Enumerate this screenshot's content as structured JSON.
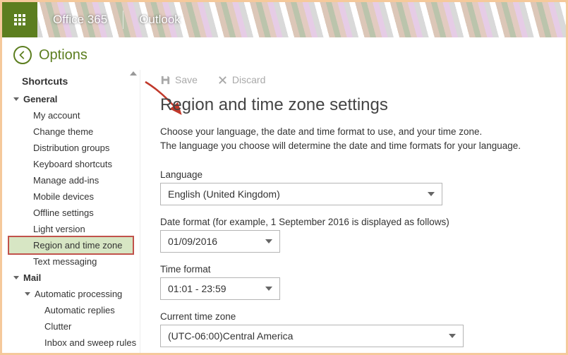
{
  "header": {
    "suite": "Office 365",
    "app": "Outlook"
  },
  "options_label": "Options",
  "sidebar": {
    "shortcuts": "Shortcuts",
    "sections": {
      "general": {
        "label": "General",
        "items": [
          "My account",
          "Change theme",
          "Distribution groups",
          "Keyboard shortcuts",
          "Manage add-ins",
          "Mobile devices",
          "Offline settings",
          "Light version",
          "Region and time zone",
          "Text messaging"
        ]
      },
      "mail": {
        "label": "Mail",
        "auto_processing": {
          "label": "Automatic processing",
          "items": [
            "Automatic replies",
            "Clutter",
            "Inbox and sweep rules"
          ]
        }
      }
    }
  },
  "toolbar": {
    "save": "Save",
    "discard": "Discard"
  },
  "page": {
    "title": "Region and time zone settings",
    "desc1": "Choose your language, the date and time format to use, and your time zone.",
    "desc2": "The language you choose will determine the date and time formats for your language.",
    "fields": {
      "language": {
        "label": "Language",
        "value": "English (United Kingdom)"
      },
      "date_format": {
        "label": "Date format (for example, 1 September 2016 is displayed as follows)",
        "value": "01/09/2016"
      },
      "time_format": {
        "label": "Time format",
        "value": "01:01 - 23:59"
      },
      "timezone": {
        "label": "Current time zone",
        "value": "(UTC-06:00)Central America"
      }
    }
  }
}
